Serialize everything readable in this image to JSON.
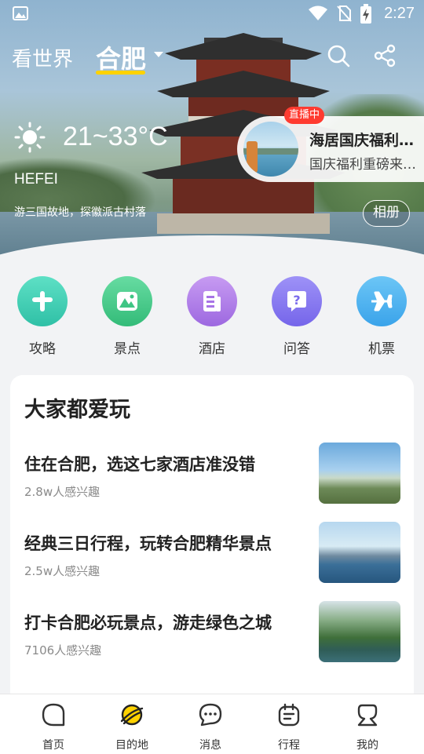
{
  "status_bar": {
    "time": "2:27",
    "icons": [
      "image-icon",
      "wifi-icon",
      "no-sim-icon",
      "battery-icon"
    ]
  },
  "header": {
    "world_tab": "看世界",
    "city_tab": "合肥",
    "accent_color": "#ffd200"
  },
  "weather": {
    "temp_range": "21~33°C",
    "icon": "sun-icon"
  },
  "city": {
    "name_en": "HEFEI",
    "description": "游三国故地，探徽派古村落",
    "album_button": "相册"
  },
  "live_card": {
    "badge": "直播中",
    "title": "海居国庆福利…",
    "subtitle": "国庆福利重磅来…",
    "badge_color": "#ff3b30"
  },
  "categories": [
    {
      "label": "攻略",
      "icon": "plus-icon",
      "color": "#3fcfb6"
    },
    {
      "label": "景点",
      "icon": "mountain-icon",
      "color": "#45c98a"
    },
    {
      "label": "酒店",
      "icon": "document-icon",
      "color": "#b07de8"
    },
    {
      "label": "问答",
      "icon": "question-icon",
      "color": "#8a7bf0"
    },
    {
      "label": "机票",
      "icon": "airplane-icon",
      "color": "#4cb3f2"
    }
  ],
  "popular": {
    "title": "大家都爱玩",
    "items": [
      {
        "title": "住在合肥，选这七家酒店准没错",
        "meta": "2.8w人感兴趣"
      },
      {
        "title": "经典三日行程，玩转合肥精华景点",
        "meta": "2.5w人感兴趣"
      },
      {
        "title": "打卡合肥必玩景点，游走绿色之城",
        "meta": "7106人感兴趣"
      }
    ]
  },
  "bottom_nav": [
    {
      "label": "首页",
      "icon": "home-icon"
    },
    {
      "label": "目的地",
      "icon": "planet-icon",
      "active_color": "#ffd200"
    },
    {
      "label": "消息",
      "icon": "message-icon"
    },
    {
      "label": "行程",
      "icon": "itinerary-icon"
    },
    {
      "label": "我的",
      "icon": "profile-icon"
    }
  ]
}
